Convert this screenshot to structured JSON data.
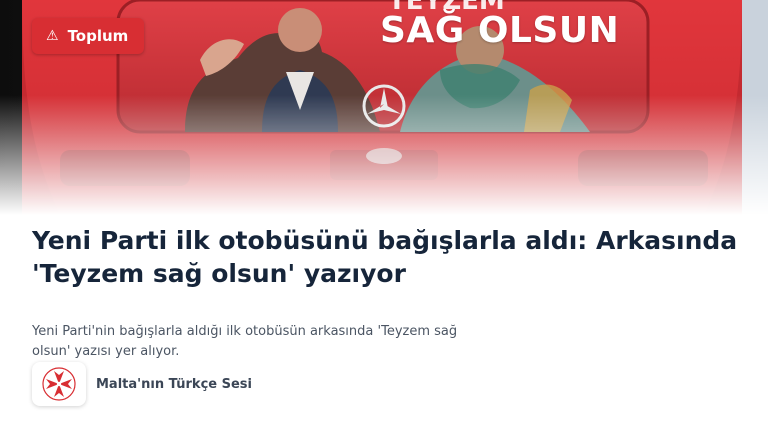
{
  "category": {
    "label": "Toplum",
    "icon": "warning-icon",
    "color": "#d82e33"
  },
  "hero": {
    "image_text": "SAĞ OLSUN"
  },
  "article": {
    "headline": "Yeni Parti ilk otobüsünü bağışlarla aldı: Arkasında 'Teyzem sağ olsun' yazıyor",
    "summary": "Yeni Parti'nin bağışlarla aldığı ilk otobüsün arkasında 'Teyzem sağ olsun' yazısı yer alıyor."
  },
  "source": {
    "name": "Malta'nın Türkçe Sesi",
    "logo_icon": "maltese-cross-icon"
  },
  "colors": {
    "headline": "#16253a",
    "summary": "#4b5563",
    "bus_red": "#d9343a"
  }
}
